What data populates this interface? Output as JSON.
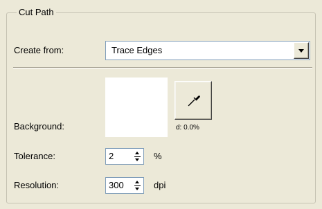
{
  "group": {
    "title": "Cut Path"
  },
  "create_from": {
    "label": "Create from:",
    "value": "Trace Edges"
  },
  "background": {
    "label": "Background:",
    "swatch_color": "#ffffff",
    "distance_text": "d: 0.0%"
  },
  "tolerance": {
    "label": "Tolerance:",
    "value": "2",
    "unit": "%"
  },
  "resolution": {
    "label": "Resolution:",
    "value": "300",
    "unit": "dpi"
  },
  "icons": {
    "eyedropper": "eyedropper-icon",
    "dropdown_arrow": "chevron-down-icon"
  }
}
